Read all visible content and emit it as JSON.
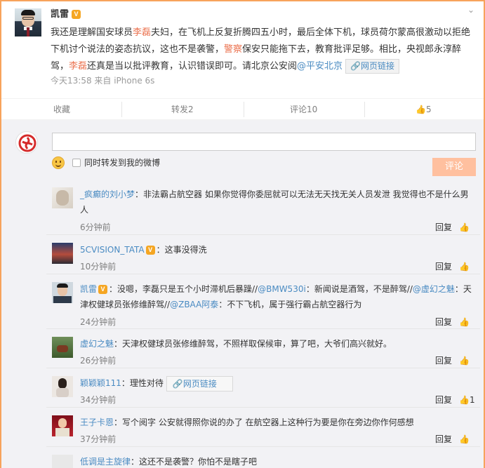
{
  "post": {
    "author": "凯雷",
    "vip_badge": "V",
    "text_parts": [
      {
        "t": "我还是理解国安球员",
        "c": "plain"
      },
      {
        "t": "李磊",
        "c": "hl"
      },
      {
        "t": "夫妇，在飞机上反复折腾四五小时，最后全体下机，球员荷尔蒙高很激动以拒绝下机讨个说法的姿态抗议，这也不是袭警，",
        "c": "plain"
      },
      {
        "t": "警察",
        "c": "hl"
      },
      {
        "t": "保安只能拖下去，教育批评足够。相比，央视郎永淳醉驾，",
        "c": "plain"
      },
      {
        "t": "李磊",
        "c": "hl"
      },
      {
        "t": "还真是当以批评教育，认识错误即可。请北京公安阅",
        "c": "plain"
      },
      {
        "t": "@平安北京",
        "c": "lnk"
      }
    ],
    "web_link": "网页链接",
    "meta": "今天13:58 来自 iPhone 6s"
  },
  "actions": {
    "collect": "收藏",
    "forward": "转发2",
    "comment": "评论10",
    "like": "5"
  },
  "comment_box": {
    "placeholder": "",
    "checkbox_label": "同时转发到我的微博",
    "submit": "评论"
  },
  "comments": [
    {
      "name": "_疯癫的刘小梦",
      "text": "：非法霸占航空器 如果你觉得你委屈就可以无法无天找无关人员发泄 我觉得也不是什么男人",
      "time": "6分钟前",
      "reply": "回复"
    },
    {
      "name": "5CVISION_TATA",
      "badge": "V",
      "text": "：这事没得洗",
      "time": "10分钟前",
      "reply": "回复"
    },
    {
      "name": "凯雷",
      "badge": "V",
      "parts": [
        {
          "t": "：没嗯，李磊只是五个小时滞机后暴躁//",
          "c": "plain"
        },
        {
          "t": "@BMW530i",
          "c": "lnk"
        },
        {
          "t": "：新闻说是酒驾，不是醉驾//",
          "c": "plain"
        },
        {
          "t": "@虚幻之魅",
          "c": "lnk"
        },
        {
          "t": "：天津权健球员张修维醉驾//",
          "c": "plain"
        },
        {
          "t": "@ZBAA阿泰",
          "c": "lnk"
        },
        {
          "t": "：不下飞机，属于强行霸占航空器行为",
          "c": "plain"
        }
      ],
      "time": "24分钟前",
      "reply": "回复"
    },
    {
      "name": "虚幻之魅",
      "text": "：天津权健球员张修维醉驾，不照样取保候审，算了吧，大爷们高兴就好。",
      "time": "26分钟前",
      "reply": "回复"
    },
    {
      "name": "颖颖颖111",
      "text": "：理性对待",
      "link": "网页链接",
      "time": "34分钟前",
      "reply": "回复",
      "likes": "1"
    },
    {
      "name": "王子卡恩",
      "text": "：写个阅字 公安就得照你说的办了 在航空器上这种行为要是你在旁边你作何感想",
      "time": "37分钟前",
      "reply": "回复"
    },
    {
      "name": "低调是主旋律",
      "text": "：这还不是袭警？你怕不是瞎子吧"
    }
  ]
}
